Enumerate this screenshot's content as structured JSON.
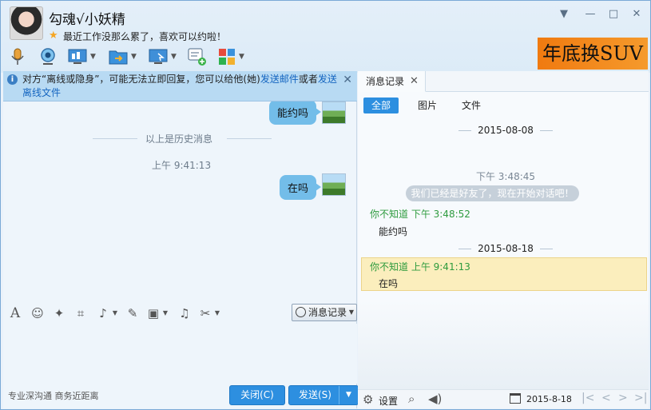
{
  "header": {
    "contact_name": "勾魂√小妖精",
    "signature": "最近工作没那么累了，喜欢可以约啦！"
  },
  "window_buttons": {
    "dropdown": "▼",
    "minimize": "—",
    "maximize": "□",
    "close": "✕"
  },
  "toolbar": {
    "icons": [
      "microphone-icon",
      "video-call-icon",
      "screen-share-icon",
      "file-transfer-icon",
      "remote-assist-icon",
      "new-chat-icon",
      "apps-icon"
    ]
  },
  "ad": {
    "text": "年底换SUV"
  },
  "notice": {
    "text_before": "对方“离线或隐身”，可能无法立即回复，您可以给他(她)",
    "link_email": "发送邮件",
    "text_mid": "或者",
    "link_offline_file": "发送离线文件"
  },
  "chat": {
    "messages": [
      {
        "text": "能约吗"
      },
      {
        "text": "在吗"
      }
    ],
    "history_label": "以上是历史消息",
    "time": "上午 9:41:13"
  },
  "input_toolbar": {
    "icons": [
      "font-icon",
      "emoji-icon",
      "magic-icon",
      "screenshot-icon",
      "voice-icon",
      "edit-icon",
      "image-icon",
      "music-icon",
      "scissors-icon"
    ],
    "history_button": "消息记录"
  },
  "footer": {
    "slogan": "专业深沟通 商务近距离",
    "close_button": "关闭(C)",
    "send_button": "发送(S)"
  },
  "history_panel": {
    "tab_label": "消息记录",
    "filters": [
      "全部",
      "图片",
      "文件"
    ],
    "date1": "2015-08-08",
    "sys_time": "下午 3:48:45",
    "sys_message": "我们已经是好友了，现在开始对话吧！",
    "record1_head": "你不知道 下午 3:48:52",
    "record1_body": "能约吗",
    "date2": "2015-08-18",
    "record2_head": "你不知道 上午 9:41:13",
    "record2_body": "在吗",
    "settings_label": "设置",
    "date_value": "2015-8-18"
  },
  "colors": {
    "accent": "#2d8fe0",
    "bubble": "#73bde9",
    "sender_green": "#2e9b3e",
    "ad_orange": "#f07a10"
  }
}
